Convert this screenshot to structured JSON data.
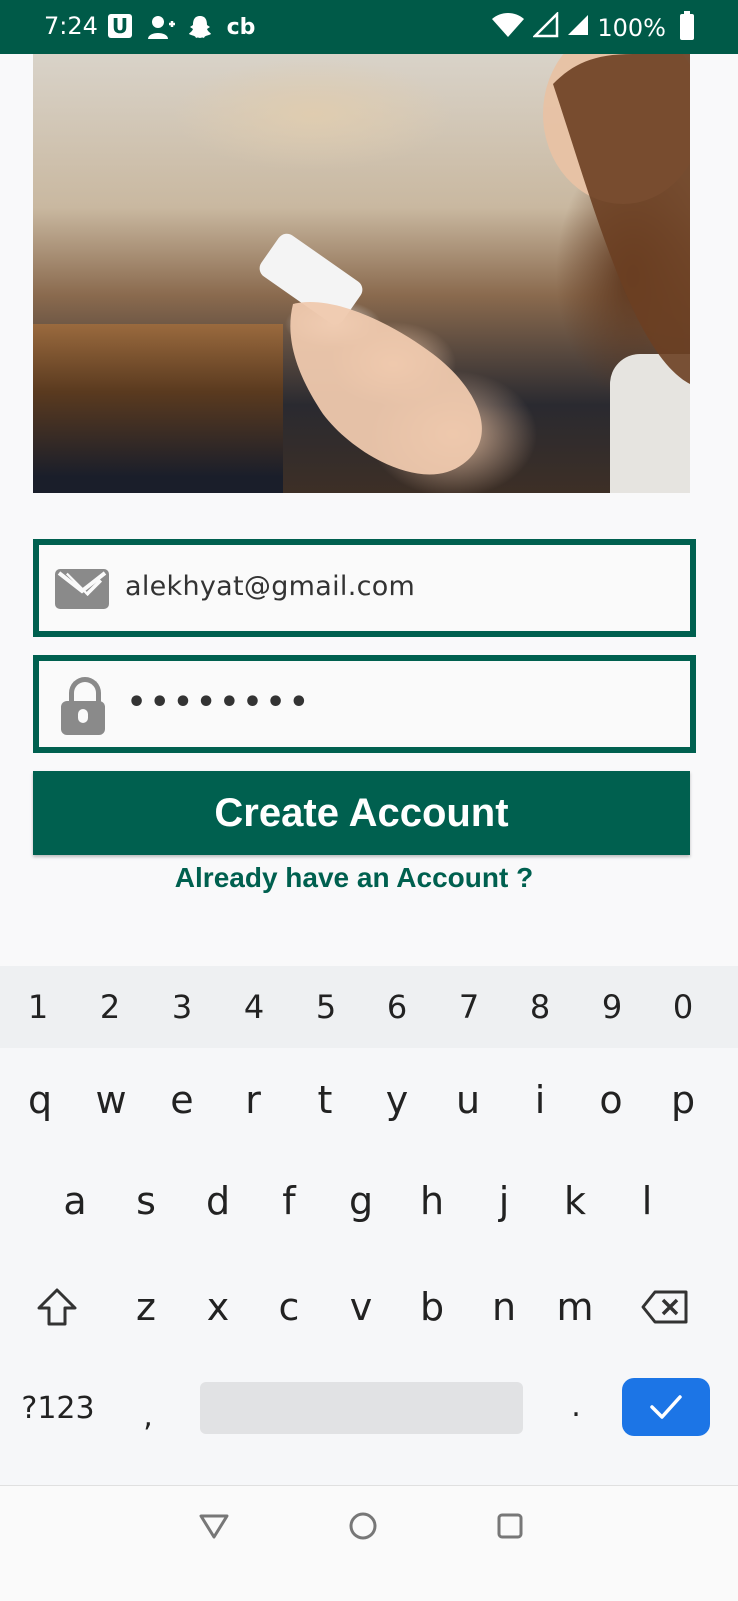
{
  "status_bar": {
    "time": "7:24",
    "app_icons": [
      "u-app-icon",
      "add-person-icon",
      "snapchat-icon",
      "cb-app-icon"
    ],
    "u_label": "U",
    "cb_label": "cb",
    "battery": "100%",
    "bg_color": "#005a48"
  },
  "form": {
    "email_value": "alekhyat@gmail.com",
    "password_mask": "••••••••",
    "create_account_label": "Create Account",
    "already_account_label": "Already have an Account ?",
    "accent_color": "#00604f"
  },
  "keyboard": {
    "number_row": [
      "1",
      "2",
      "3",
      "4",
      "5",
      "6",
      "7",
      "8",
      "9",
      "0"
    ],
    "row1": [
      "q",
      "w",
      "e",
      "r",
      "t",
      "y",
      "u",
      "i",
      "o",
      "p"
    ],
    "row2": [
      "a",
      "s",
      "d",
      "f",
      "g",
      "h",
      "j",
      "k",
      "l"
    ],
    "row3": [
      "z",
      "x",
      "c",
      "v",
      "b",
      "n",
      "m"
    ],
    "symbols_label": "?123",
    "comma": ",",
    "period": ".",
    "enter_color": "#1c75e6"
  },
  "nav_bar": {
    "buttons": [
      "back-icon",
      "home-icon",
      "recents-icon"
    ]
  }
}
